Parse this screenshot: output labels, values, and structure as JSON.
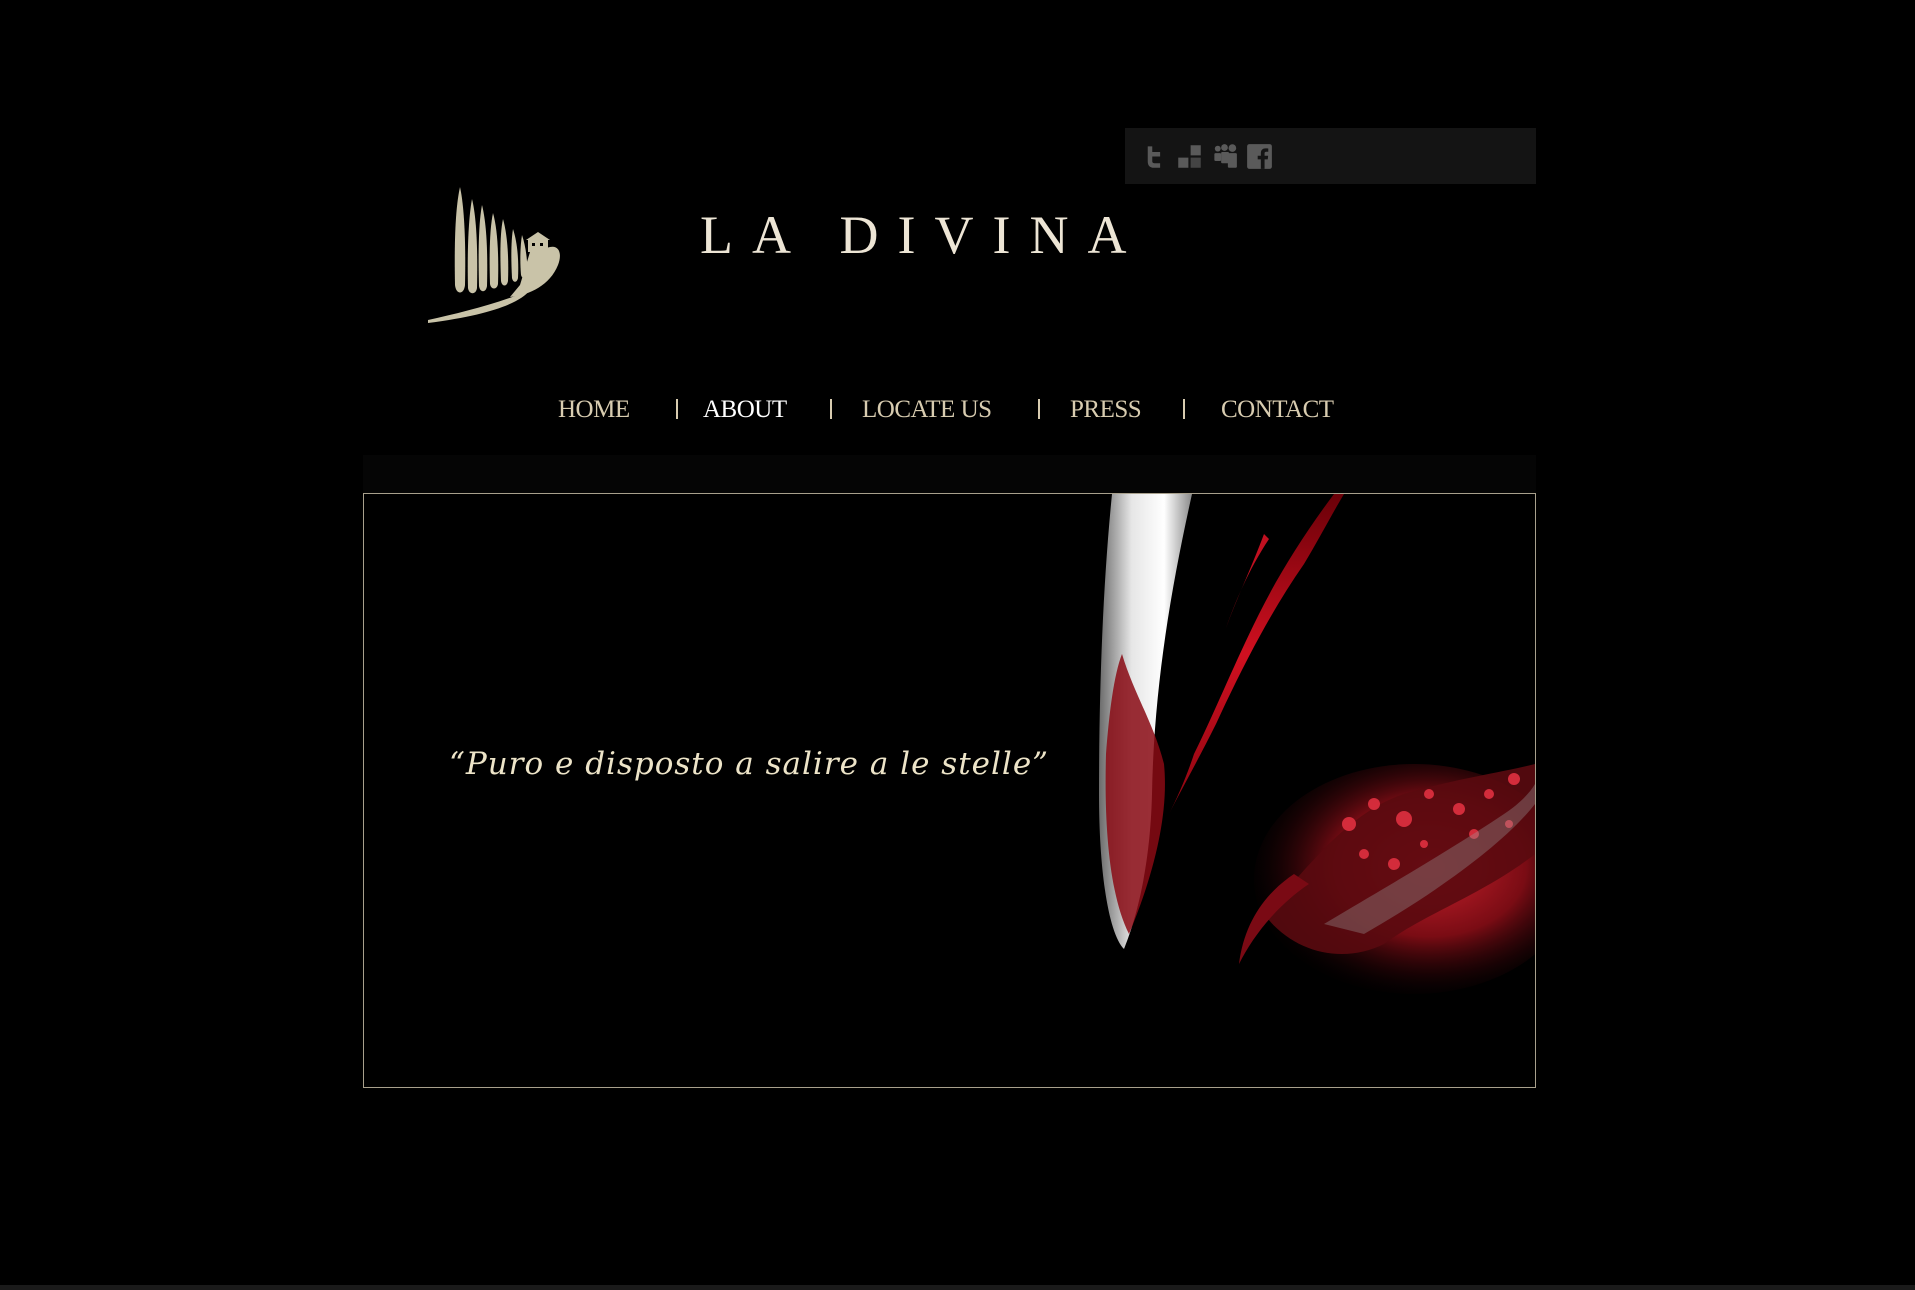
{
  "site": {
    "title": "LA DIVINA",
    "logo_icon": "cypress-trees-logo-icon"
  },
  "social": {
    "icons": [
      "twitter-icon",
      "delicious-icon",
      "myspace-icon",
      "facebook-icon"
    ],
    "icon_color": "#5a5a5a"
  },
  "nav": {
    "items": [
      {
        "label": "HOME",
        "active": false
      },
      {
        "label": "ABOUT",
        "active": true
      },
      {
        "label": "LOCATE US",
        "active": false
      },
      {
        "label": "PRESS",
        "active": false
      },
      {
        "label": "CONTACT",
        "active": false
      }
    ]
  },
  "hero": {
    "tagline": "“Puro e disposto a salire a le stelle”",
    "image": "red-wine-pouring-into-glass"
  },
  "colors": {
    "background": "#000000",
    "text_cream": "#d8ccb0",
    "title": "#ede5d5",
    "hero_border": "#a8a08c",
    "wine_red": "#b0101a"
  }
}
